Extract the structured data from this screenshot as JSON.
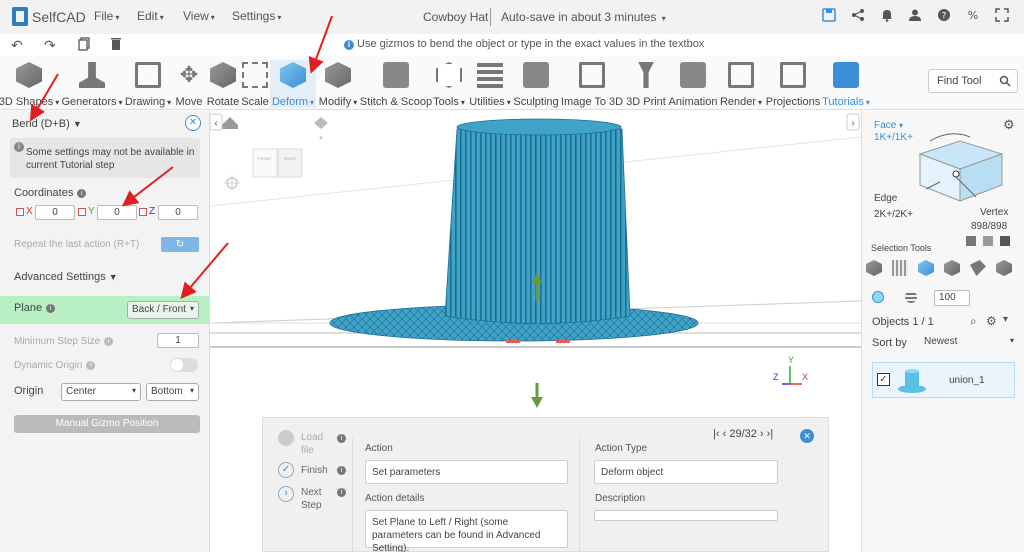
{
  "app": {
    "logo_text": "SelfCAD",
    "menus": [
      "File",
      "Edit",
      "View",
      "Settings"
    ],
    "doc_title": "Cowboy Hat",
    "autosave": "Auto-save in about 3 minutes"
  },
  "hint": "Use gizmos to bend the object or type in the exact values in the textbox",
  "toolbar": {
    "tools": [
      "3D Shapes",
      "Generators",
      "Drawing",
      "Move",
      "Rotate",
      "Scale",
      "Deform",
      "Modify",
      "Stitch & Scoop",
      "Tools",
      "Utilities",
      "Sculpting",
      "Image To 3D",
      "3D Print",
      "Animation",
      "Render",
      "Projections",
      "Tutorials"
    ],
    "find_tool": "Find Tool"
  },
  "left": {
    "title": "Bend (D+B)",
    "notice": "Some settings may not be available in current Tutorial step",
    "coordinates_label": "Coordinates",
    "x_label": "X",
    "x_value": "0",
    "y_label": "Y",
    "y_value": "0",
    "z_label": "Z",
    "z_value": "0",
    "repeat_label": "Repeat the last action (R+T)",
    "advanced_label": "Advanced Settings",
    "plane_label": "Plane",
    "plane_value": "Back / Front",
    "min_step_label": "Minimum Step Size",
    "min_step_value": "1",
    "dynamic_origin_label": "Dynamic Origin",
    "origin_label": "Origin",
    "origin_h": "Center",
    "origin_v": "Bottom",
    "gizmo_button": "Manual Gizmo Position"
  },
  "viewport": {
    "view_cube_left": "FRONT",
    "view_cube_right": "RIGHT",
    "axis_z": "Z",
    "axis_y": "Y",
    "axis_x": "X"
  },
  "right": {
    "face_label": "Face",
    "face_count": "1K+/1K+",
    "edge_label": "Edge",
    "edge_count": "2K+/2K+",
    "vertex_label": "Vertex",
    "vertex_count": "898/898",
    "selection_tools": "Selection Tools",
    "zoom_value": "100",
    "objects_label": "Objects 1 / 1",
    "sort_label": "Sort by",
    "sort_value": "Newest",
    "object_name": "union_1"
  },
  "tutorial": {
    "step_load": "Load file",
    "step_finish": "Finish",
    "step_next": "Next Step",
    "counter": "29/32",
    "action_label": "Action",
    "action_value": "Set parameters",
    "action_type_label": "Action Type",
    "action_type_value": "Deform object",
    "details_label": "Action details",
    "details_value": "Set Plane to Left / Right (some parameters can be found in Advanced Setting).",
    "description_label": "Description",
    "description_value": ""
  },
  "colors": {
    "accent": "#3b8fd6",
    "hat": "#3fa3c7",
    "plane_highlight": "#b8f0c4",
    "arrow": "#e02020"
  }
}
